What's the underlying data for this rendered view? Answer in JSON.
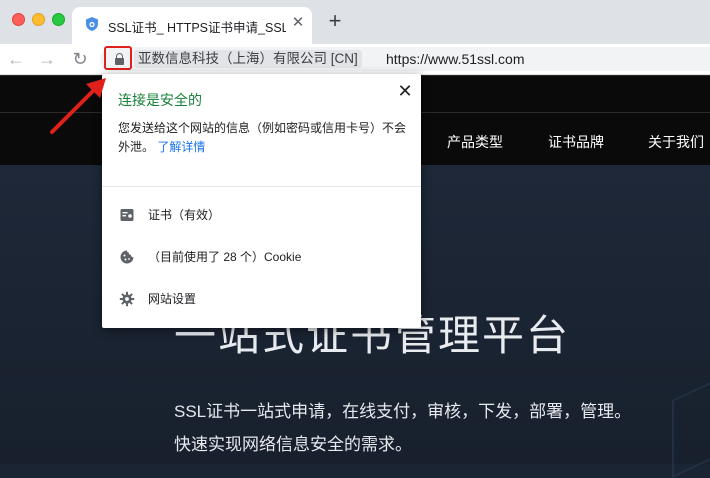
{
  "browser": {
    "tab": {
      "title": "SSL证书_ HTTPS证书申请_SSL",
      "close": "✕"
    },
    "new_tab": "+",
    "nav": {
      "back": "←",
      "forward": "→",
      "reload": "↻"
    },
    "site_identity": "亚数信息科技（上海）有限公司 [CN]",
    "url": "https://www.51ssl.com"
  },
  "website": {
    "nav_items": [
      "产品类型",
      "证书品牌",
      "关于我们"
    ],
    "hero": {
      "title": "一站式证书管理平台",
      "subtitle_line1": "SSL证书一站式申请，在线支付，审核，下发，部署，管理。",
      "subtitle_line2": "快速实现网络信息安全的需求。"
    }
  },
  "popup": {
    "title": "连接是安全的",
    "close": "✕",
    "description": "您发送给这个网站的信息（例如密码或信用卡号）不会外泄。",
    "learn_more": "了解详情",
    "items": [
      {
        "icon": "certificate-icon",
        "label": "证书（有效）"
      },
      {
        "icon": "cookie-icon",
        "label": "（目前使用了 28 个）Cookie"
      },
      {
        "icon": "gear-icon",
        "label": "网站设置"
      }
    ]
  },
  "colors": {
    "secure_green": "#188038",
    "link_blue": "#1a73e8",
    "highlight_red": "#e0201b"
  }
}
